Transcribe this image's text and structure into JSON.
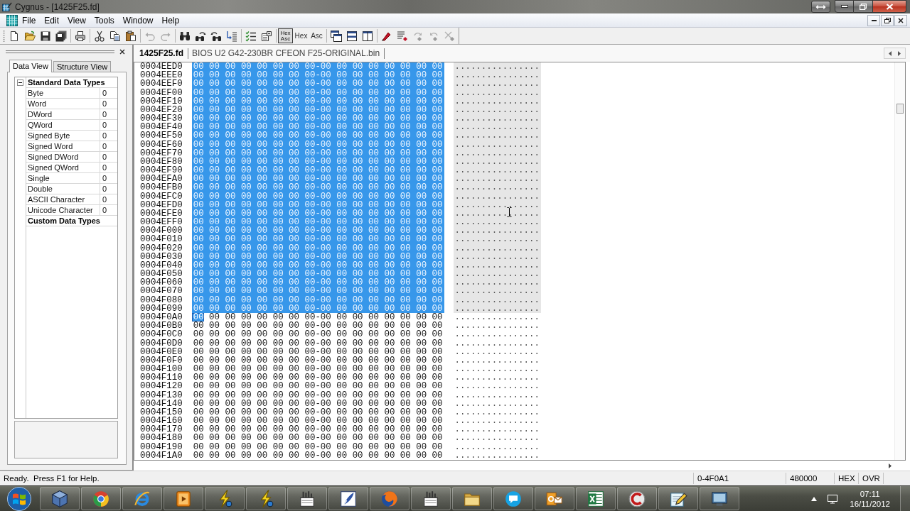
{
  "window": {
    "title": "Cygnus - [1425F25.fd]"
  },
  "menu": {
    "items": [
      "File",
      "Edit",
      "View",
      "Tools",
      "Window",
      "Help"
    ]
  },
  "toolbar": {
    "groups": [
      {
        "buttons": [
          {
            "kind": "icon",
            "disabled": false
          },
          {
            "kind": "icon",
            "disabled": false
          },
          {
            "kind": "icon",
            "disabled": false
          },
          {
            "kind": "icon",
            "disabled": false
          }
        ]
      },
      {
        "buttons": [
          {
            "kind": "icon",
            "disabled": false
          }
        ]
      },
      {
        "buttons": [
          {
            "kind": "icon",
            "disabled": false
          },
          {
            "kind": "icon",
            "disabled": false
          },
          {
            "kind": "icon",
            "disabled": false
          }
        ]
      },
      {
        "buttons": [
          {
            "kind": "icon",
            "disabled": true
          },
          {
            "kind": "icon",
            "disabled": true
          }
        ]
      },
      {
        "buttons": [
          {
            "kind": "icon",
            "disabled": false
          },
          {
            "kind": "icon",
            "disabled": false
          },
          {
            "kind": "icon",
            "disabled": false
          },
          {
            "kind": "icon",
            "disabled": false
          }
        ]
      },
      {
        "buttons": [
          {
            "kind": "icon",
            "disabled": false
          },
          {
            "kind": "icon",
            "disabled": false
          }
        ]
      },
      {
        "buttons": [
          {
            "kind": "text",
            "lines": [
              "Hex",
              "Asc"
            ],
            "selected": true
          },
          {
            "kind": "text",
            "lines": [
              "Hex"
            ],
            "selected": false
          },
          {
            "kind": "text",
            "lines": [
              "Asc"
            ],
            "selected": false
          }
        ]
      },
      {
        "buttons": [
          {
            "kind": "icon",
            "disabled": false
          },
          {
            "kind": "icon",
            "disabled": false
          },
          {
            "kind": "icon",
            "disabled": false
          }
        ]
      },
      {
        "buttons": [
          {
            "kind": "icon",
            "disabled": false
          },
          {
            "kind": "icon",
            "disabled": false
          },
          {
            "kind": "icon",
            "disabled": true
          },
          {
            "kind": "icon",
            "disabled": true
          },
          {
            "kind": "icon",
            "disabled": true
          }
        ]
      }
    ]
  },
  "data_panel": {
    "tabs": [
      {
        "label": "Data View",
        "selected": true
      },
      {
        "label": "Structure View",
        "selected": false
      }
    ],
    "grid": {
      "categories": [
        {
          "name": "Standard Data Types",
          "expanded": true,
          "items": [
            {
              "name": "Byte",
              "value": "0"
            },
            {
              "name": "Word",
              "value": "0"
            },
            {
              "name": "DWord",
              "value": "0"
            },
            {
              "name": "QWord",
              "value": "0"
            },
            {
              "name": "Signed Byte",
              "value": "0"
            },
            {
              "name": "Signed Word",
              "value": "0"
            },
            {
              "name": "Signed DWord",
              "value": "0"
            },
            {
              "name": "Signed QWord",
              "value": "0"
            },
            {
              "name": "Single",
              "value": "0"
            },
            {
              "name": "Double",
              "value": "0"
            },
            {
              "name": "ASCII Character",
              "value": "0"
            },
            {
              "name": "Unicode Character",
              "value": "0"
            }
          ]
        },
        {
          "name": "Custom Data Types"
        }
      ]
    }
  },
  "doc_tabs": [
    {
      "label": "1425F25.fd",
      "selected": true
    },
    {
      "label": "BIOS U2 G42-230BR CFEON F25-ORIGINAL.bin",
      "selected": false
    }
  ],
  "hex_view": {
    "rows": [
      {
        "offset": "0004EED0",
        "hex": "00 00 00 00 00 00 00 00-00 00 00 00 00 00 00 00",
        "ascii": "................",
        "selected": true,
        "caret": false
      },
      {
        "offset": "0004EEE0",
        "hex": "00 00 00 00 00 00 00 00-00 00 00 00 00 00 00 00",
        "ascii": "................",
        "selected": true,
        "caret": false
      },
      {
        "offset": "0004EEF0",
        "hex": "00 00 00 00 00 00 00 00-00 00 00 00 00 00 00 00",
        "ascii": "................",
        "selected": true,
        "caret": false
      },
      {
        "offset": "0004EF00",
        "hex": "00 00 00 00 00 00 00 00-00 00 00 00 00 00 00 00",
        "ascii": "................",
        "selected": true,
        "caret": false
      },
      {
        "offset": "0004EF10",
        "hex": "00 00 00 00 00 00 00 00-00 00 00 00 00 00 00 00",
        "ascii": "................",
        "selected": true,
        "caret": false
      },
      {
        "offset": "0004EF20",
        "hex": "00 00 00 00 00 00 00 00-00 00 00 00 00 00 00 00",
        "ascii": "................",
        "selected": true,
        "caret": false
      },
      {
        "offset": "0004EF30",
        "hex": "00 00 00 00 00 00 00 00-00 00 00 00 00 00 00 00",
        "ascii": "................",
        "selected": true,
        "caret": false
      },
      {
        "offset": "0004EF40",
        "hex": "00 00 00 00 00 00 00 00-00 00 00 00 00 00 00 00",
        "ascii": "................",
        "selected": true,
        "caret": false
      },
      {
        "offset": "0004EF50",
        "hex": "00 00 00 00 00 00 00 00-00 00 00 00 00 00 00 00",
        "ascii": "................",
        "selected": true,
        "caret": false
      },
      {
        "offset": "0004EF60",
        "hex": "00 00 00 00 00 00 00 00-00 00 00 00 00 00 00 00",
        "ascii": "................",
        "selected": true,
        "caret": false
      },
      {
        "offset": "0004EF70",
        "hex": "00 00 00 00 00 00 00 00-00 00 00 00 00 00 00 00",
        "ascii": "................",
        "selected": true,
        "caret": false
      },
      {
        "offset": "0004EF80",
        "hex": "00 00 00 00 00 00 00 00-00 00 00 00 00 00 00 00",
        "ascii": "................",
        "selected": true,
        "caret": false
      },
      {
        "offset": "0004EF90",
        "hex": "00 00 00 00 00 00 00 00-00 00 00 00 00 00 00 00",
        "ascii": "................",
        "selected": true,
        "caret": false
      },
      {
        "offset": "0004EFA0",
        "hex": "00 00 00 00 00 00 00 00-00 00 00 00 00 00 00 00",
        "ascii": "................",
        "selected": true,
        "caret": false
      },
      {
        "offset": "0004EFB0",
        "hex": "00 00 00 00 00 00 00 00-00 00 00 00 00 00 00 00",
        "ascii": "................",
        "selected": true,
        "caret": false
      },
      {
        "offset": "0004EFC0",
        "hex": "00 00 00 00 00 00 00 00-00 00 00 00 00 00 00 00",
        "ascii": "................",
        "selected": true,
        "caret": false
      },
      {
        "offset": "0004EFD0",
        "hex": "00 00 00 00 00 00 00 00-00 00 00 00 00 00 00 00",
        "ascii": "................",
        "selected": true,
        "caret": false
      },
      {
        "offset": "0004EFE0",
        "hex": "00 00 00 00 00 00 00 00-00 00 00 00 00 00 00 00",
        "ascii": "................",
        "selected": true,
        "caret": false
      },
      {
        "offset": "0004EFF0",
        "hex": "00 00 00 00 00 00 00 00-00 00 00 00 00 00 00 00",
        "ascii": "................",
        "selected": true,
        "caret": false
      },
      {
        "offset": "0004F000",
        "hex": "00 00 00 00 00 00 00 00-00 00 00 00 00 00 00 00",
        "ascii": "................",
        "selected": true,
        "caret": false
      },
      {
        "offset": "0004F010",
        "hex": "00 00 00 00 00 00 00 00-00 00 00 00 00 00 00 00",
        "ascii": "................",
        "selected": true,
        "caret": false
      },
      {
        "offset": "0004F020",
        "hex": "00 00 00 00 00 00 00 00-00 00 00 00 00 00 00 00",
        "ascii": "................",
        "selected": true,
        "caret": false
      },
      {
        "offset": "0004F030",
        "hex": "00 00 00 00 00 00 00 00-00 00 00 00 00 00 00 00",
        "ascii": "................",
        "selected": true,
        "caret": false
      },
      {
        "offset": "0004F040",
        "hex": "00 00 00 00 00 00 00 00-00 00 00 00 00 00 00 00",
        "ascii": "................",
        "selected": true,
        "caret": false
      },
      {
        "offset": "0004F050",
        "hex": "00 00 00 00 00 00 00 00-00 00 00 00 00 00 00 00",
        "ascii": "................",
        "selected": true,
        "caret": false
      },
      {
        "offset": "0004F060",
        "hex": "00 00 00 00 00 00 00 00-00 00 00 00 00 00 00 00",
        "ascii": "................",
        "selected": true,
        "caret": false
      },
      {
        "offset": "0004F070",
        "hex": "00 00 00 00 00 00 00 00-00 00 00 00 00 00 00 00",
        "ascii": "................",
        "selected": true,
        "caret": false
      },
      {
        "offset": "0004F080",
        "hex": "00 00 00 00 00 00 00 00-00 00 00 00 00 00 00 00",
        "ascii": "................",
        "selected": true,
        "caret": false
      },
      {
        "offset": "0004F090",
        "hex": "00 00 00 00 00 00 00 00-00 00 00 00 00 00 00 00",
        "ascii": "................",
        "selected": true,
        "caret": false
      },
      {
        "offset": "0004F0A0",
        "hex": "00 00 00 00 00 00 00 00-00 00 00 00 00 00 00 00",
        "ascii": "................",
        "selected": false,
        "caret": true
      },
      {
        "offset": "0004F0B0",
        "hex": "00 00 00 00 00 00 00 00-00 00 00 00 00 00 00 00",
        "ascii": "................",
        "selected": false,
        "caret": false
      },
      {
        "offset": "0004F0C0",
        "hex": "00 00 00 00 00 00 00 00-00 00 00 00 00 00 00 00",
        "ascii": "................",
        "selected": false,
        "caret": false
      },
      {
        "offset": "0004F0D0",
        "hex": "00 00 00 00 00 00 00 00-00 00 00 00 00 00 00 00",
        "ascii": "................",
        "selected": false,
        "caret": false
      },
      {
        "offset": "0004F0E0",
        "hex": "00 00 00 00 00 00 00 00-00 00 00 00 00 00 00 00",
        "ascii": "................",
        "selected": false,
        "caret": false
      },
      {
        "offset": "0004F0F0",
        "hex": "00 00 00 00 00 00 00 00-00 00 00 00 00 00 00 00",
        "ascii": "................",
        "selected": false,
        "caret": false
      },
      {
        "offset": "0004F100",
        "hex": "00 00 00 00 00 00 00 00-00 00 00 00 00 00 00 00",
        "ascii": "................",
        "selected": false,
        "caret": false
      },
      {
        "offset": "0004F110",
        "hex": "00 00 00 00 00 00 00 00-00 00 00 00 00 00 00 00",
        "ascii": "................",
        "selected": false,
        "caret": false
      },
      {
        "offset": "0004F120",
        "hex": "00 00 00 00 00 00 00 00-00 00 00 00 00 00 00 00",
        "ascii": "................",
        "selected": false,
        "caret": false
      },
      {
        "offset": "0004F130",
        "hex": "00 00 00 00 00 00 00 00-00 00 00 00 00 00 00 00",
        "ascii": "................",
        "selected": false,
        "caret": false
      },
      {
        "offset": "0004F140",
        "hex": "00 00 00 00 00 00 00 00-00 00 00 00 00 00 00 00",
        "ascii": "................",
        "selected": false,
        "caret": false
      },
      {
        "offset": "0004F150",
        "hex": "00 00 00 00 00 00 00 00-00 00 00 00 00 00 00 00",
        "ascii": "................",
        "selected": false,
        "caret": false
      },
      {
        "offset": "0004F160",
        "hex": "00 00 00 00 00 00 00 00-00 00 00 00 00 00 00 00",
        "ascii": "................",
        "selected": false,
        "caret": false
      },
      {
        "offset": "0004F170",
        "hex": "00 00 00 00 00 00 00 00-00 00 00 00 00 00 00 00",
        "ascii": "................",
        "selected": false,
        "caret": false
      },
      {
        "offset": "0004F180",
        "hex": "00 00 00 00 00 00 00 00-00 00 00 00 00 00 00 00",
        "ascii": "................",
        "selected": false,
        "caret": false
      },
      {
        "offset": "0004F190",
        "hex": "00 00 00 00 00 00 00 00-00 00 00 00 00 00 00 00",
        "ascii": "................",
        "selected": false,
        "caret": false
      },
      {
        "offset": "0004F1A0",
        "hex": "00 00 00 00 00 00 00 00-00 00 00 00 00 00 00 00",
        "ascii": "................",
        "selected": false,
        "caret": false
      }
    ]
  },
  "status_bar": {
    "message": "Ready.  Press F1 for Help.",
    "panes": [
      "0-4F0A1",
      "480000",
      "HEX",
      "OVR"
    ]
  },
  "taskbar": {
    "clock": {
      "time": "07:11",
      "date": "16/11/2012"
    }
  }
}
